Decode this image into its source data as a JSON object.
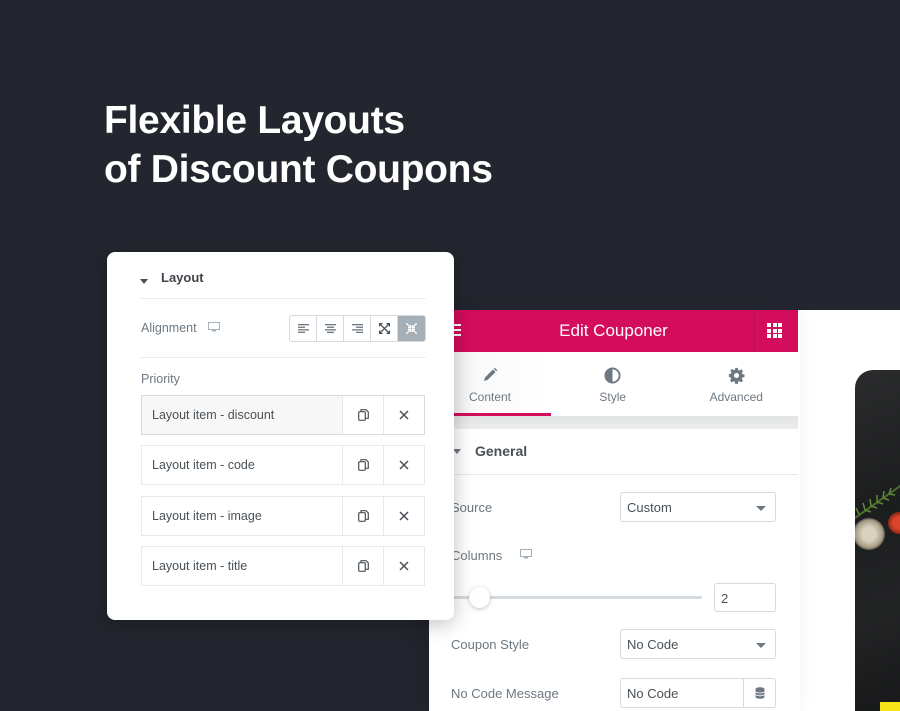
{
  "headline": {
    "line1": "Flexible Layouts",
    "line2": "of Discount Coupons"
  },
  "layout_panel": {
    "section_title": "Layout",
    "alignment_label": "Alignment",
    "alignment_options": [
      {
        "name": "align-left",
        "icon": "align-left-icon"
      },
      {
        "name": "align-center",
        "icon": "align-center-icon"
      },
      {
        "name": "align-right",
        "icon": "align-right-icon"
      },
      {
        "name": "expand",
        "icon": "expand-icon"
      },
      {
        "name": "compress",
        "icon": "compress-icon",
        "selected": true
      }
    ],
    "priority_label": "Priority",
    "items": [
      {
        "title": "Layout item - discount"
      },
      {
        "title": "Layout item - code"
      },
      {
        "title": "Layout item - image"
      },
      {
        "title": "Layout item - title"
      }
    ]
  },
  "editor": {
    "title": "Edit Couponer",
    "accent_color": "#d30c5c",
    "tabs": [
      {
        "label": "Content",
        "icon": "pencil-icon",
        "active": true
      },
      {
        "label": "Style",
        "icon": "half-circle-icon",
        "active": false
      },
      {
        "label": "Advanced",
        "icon": "gear-icon",
        "active": false
      }
    ],
    "section": "General",
    "source": {
      "label": "Source",
      "value": "Custom"
    },
    "columns": {
      "label": "Columns",
      "slider_value": 2,
      "value": "2"
    },
    "coupon_style": {
      "label": "Coupon Style",
      "value": "No Code"
    },
    "no_code_message": {
      "label": "No Code Message",
      "value": "No Code"
    }
  }
}
